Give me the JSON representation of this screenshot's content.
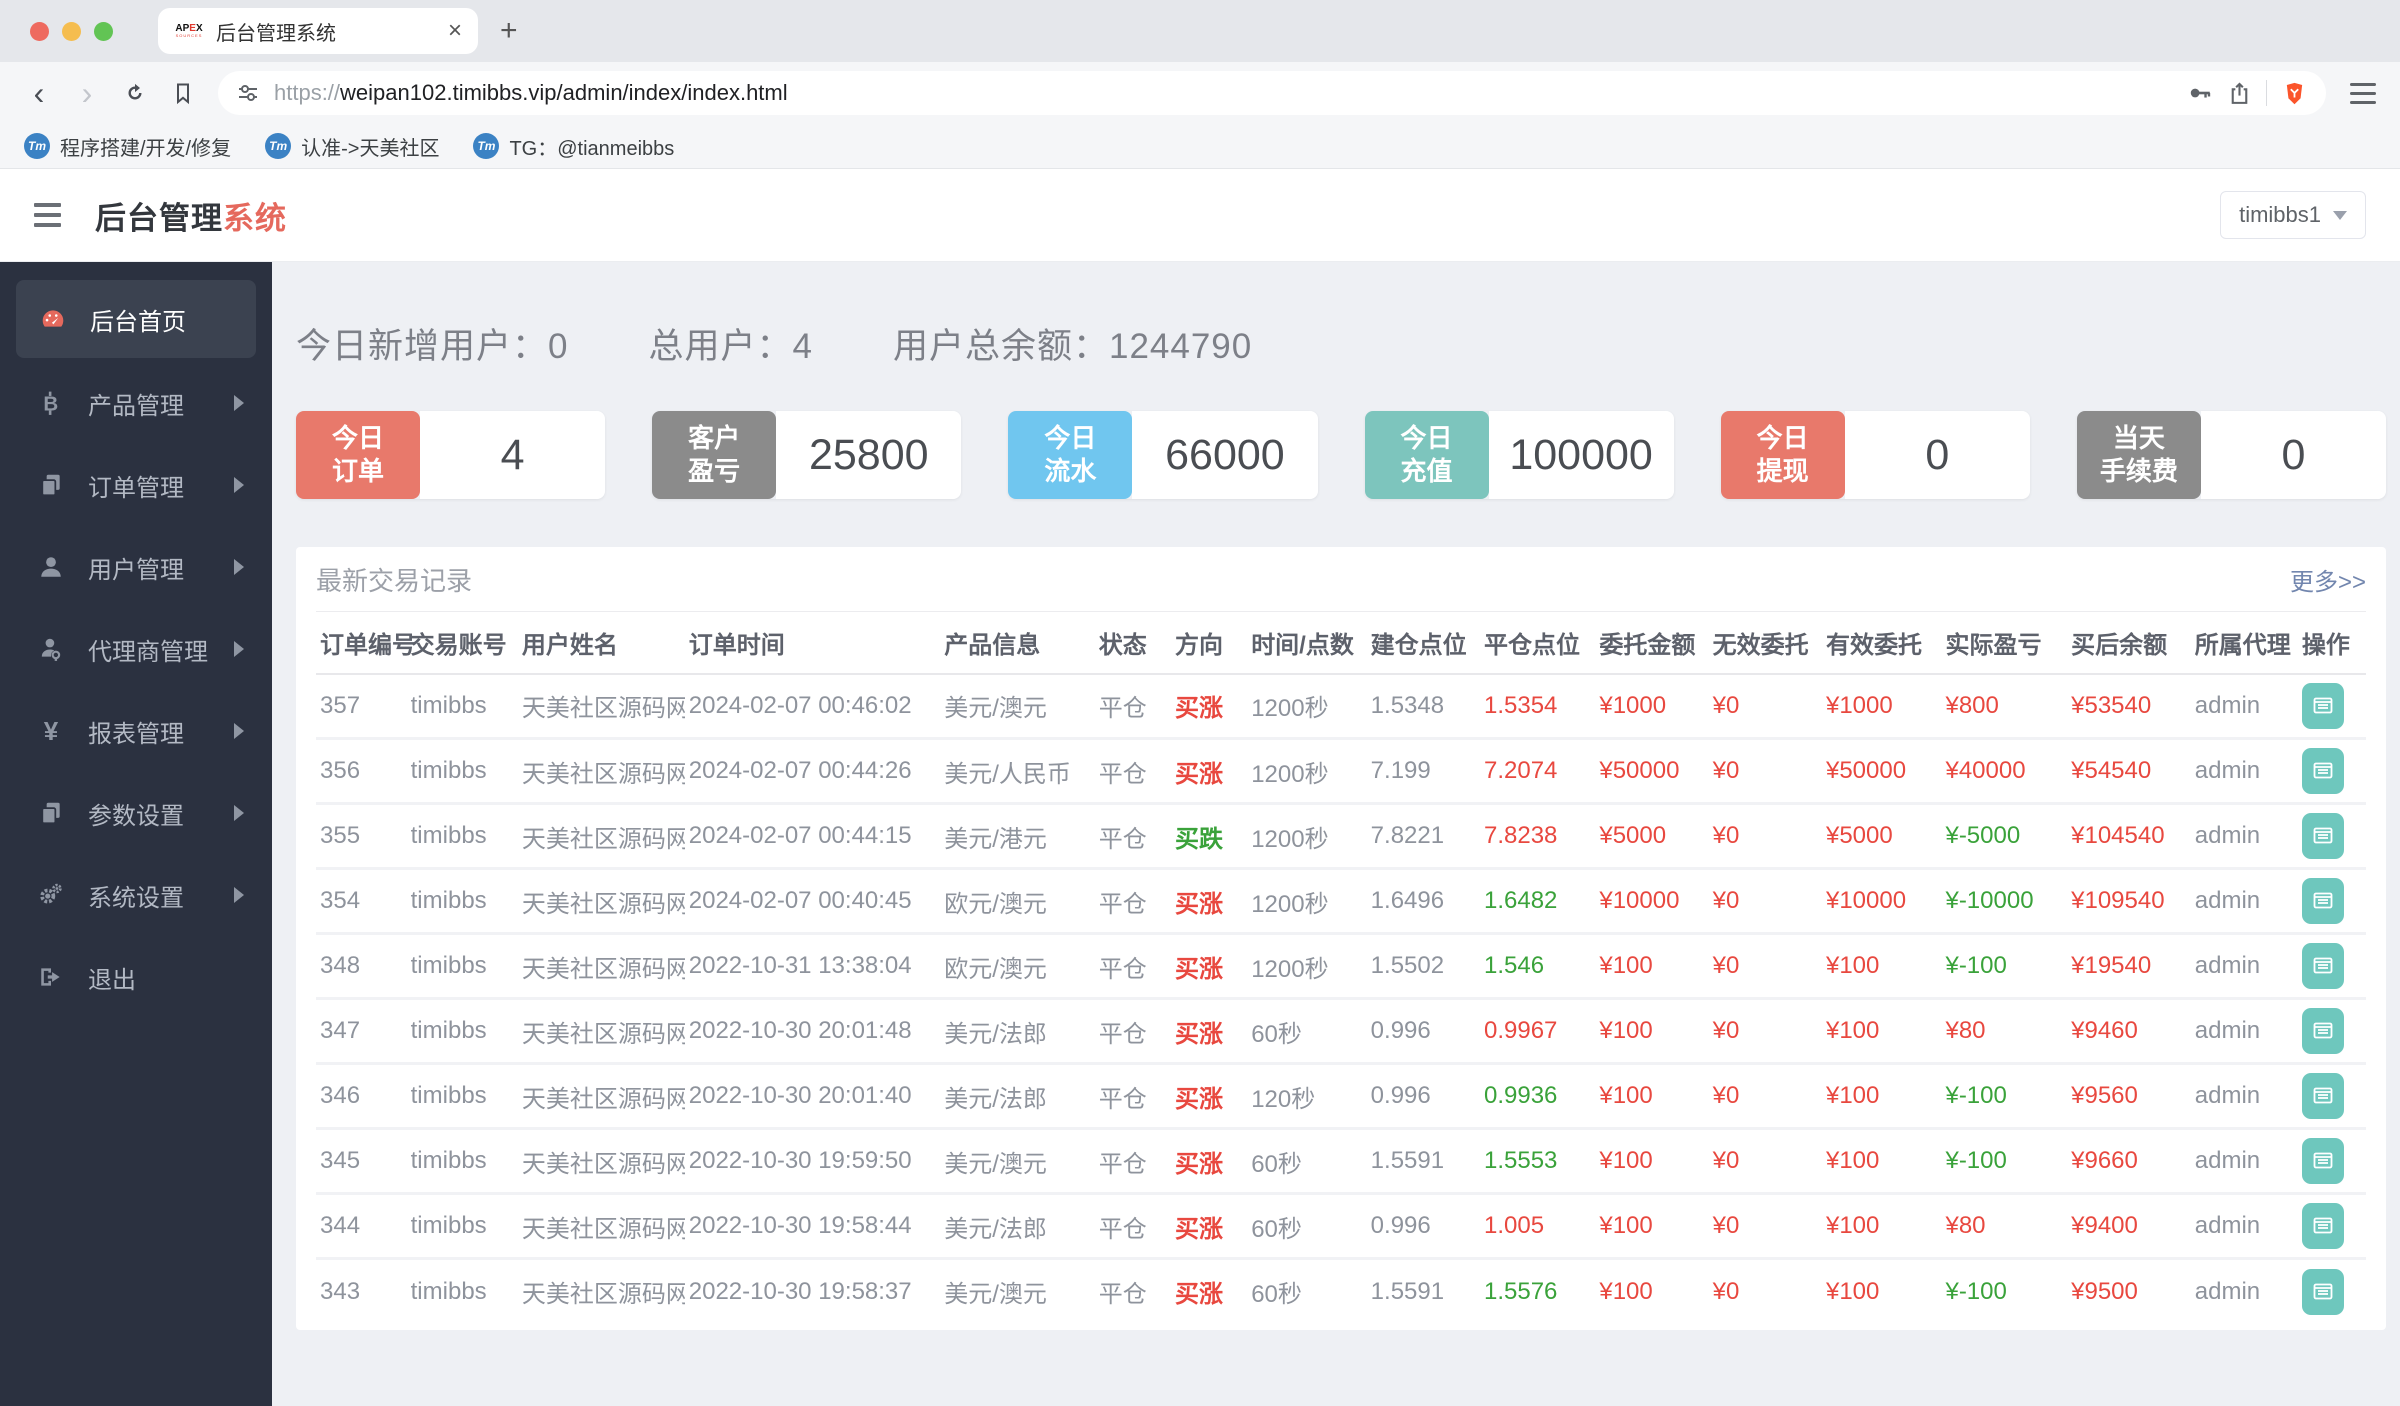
{
  "browser": {
    "tab": {
      "title": "后台管理系统",
      "favicon_line1": "APEX",
      "favicon_line2": "SOURCES"
    },
    "url": {
      "scheme": "https://",
      "host": "weipan102.timibbs.vip",
      "path": "/admin/index/index.html"
    },
    "bookmark_icon_text": "Tm",
    "bookmarks": [
      {
        "label": "程序搭建/开发/修复"
      },
      {
        "label": "认准->天美社区"
      },
      {
        "label": "TG：@tianmeibbs"
      }
    ]
  },
  "header": {
    "title_black": "后台管理",
    "title_red": "系统",
    "user": "timibbs1"
  },
  "sidebar": {
    "items": [
      {
        "label": "后台首页"
      },
      {
        "label": "产品管理"
      },
      {
        "label": "订单管理"
      },
      {
        "label": "用户管理"
      },
      {
        "label": "代理商管理"
      },
      {
        "label": "报表管理"
      },
      {
        "label": "参数设置"
      },
      {
        "label": "系统设置"
      },
      {
        "label": "退出"
      }
    ]
  },
  "stats": {
    "new_users_label": "今日新增用户：",
    "new_users": "0",
    "total_users_label": "总用户：",
    "total_users": "4",
    "total_balance_label": "用户总余额：",
    "total_balance": "1244790"
  },
  "cards": [
    {
      "line1": "今日",
      "line2": "订单",
      "value": "4",
      "color": "#e8796b"
    },
    {
      "line1": "客户",
      "line2": "盈亏",
      "value": "25800",
      "color": "#8b8b8b"
    },
    {
      "line1": "今日",
      "line2": "流水",
      "value": "66000",
      "color": "#70c6ef"
    },
    {
      "line1": "今日",
      "line2": "充值",
      "value": "100000",
      "color": "#7dc5bd"
    },
    {
      "line1": "今日",
      "line2": "提现",
      "value": "0",
      "color": "#e8796b"
    },
    {
      "line1": "当天",
      "line2": "手续费",
      "value": "0",
      "color": "#8b8b8b"
    }
  ],
  "table": {
    "title": "最新交易记录",
    "more_link": "更多>>",
    "columns": [
      "订单编号",
      "交易账号",
      "用户姓名",
      "订单时间",
      "产品信息",
      "状态",
      "方向",
      "时间/点数",
      "建仓点位",
      "平仓点位",
      "委托金额",
      "无效委托",
      "有效委托",
      "实际盈亏",
      "买后余额",
      "所属代理",
      "操作"
    ],
    "rows": [
      {
        "id": "357",
        "account": "timibbs",
        "name": "天美社区源码网",
        "time": "2024-02-07 00:46:02",
        "product": "美元/澳元",
        "status": "平仓",
        "direction": "买涨",
        "direction_color": "red",
        "duration": "1200秒",
        "open": "1.5348",
        "close": "1.5354",
        "close_color": "red",
        "amount": "¥1000",
        "invalid": "¥0",
        "valid": "¥1000",
        "profit": "¥800",
        "profit_color": "red",
        "balance": "¥53540",
        "agent": "admin"
      },
      {
        "id": "356",
        "account": "timibbs",
        "name": "天美社区源码网",
        "time": "2024-02-07 00:44:26",
        "product": "美元/人民币",
        "status": "平仓",
        "direction": "买涨",
        "direction_color": "red",
        "duration": "1200秒",
        "open": "7.199",
        "close": "7.2074",
        "close_color": "red",
        "amount": "¥50000",
        "invalid": "¥0",
        "valid": "¥50000",
        "profit": "¥40000",
        "profit_color": "red",
        "balance": "¥54540",
        "agent": "admin"
      },
      {
        "id": "355",
        "account": "timibbs",
        "name": "天美社区源码网",
        "time": "2024-02-07 00:44:15",
        "product": "美元/港元",
        "status": "平仓",
        "direction": "买跌",
        "direction_color": "green",
        "duration": "1200秒",
        "open": "7.8221",
        "close": "7.8238",
        "close_color": "red",
        "amount": "¥5000",
        "invalid": "¥0",
        "valid": "¥5000",
        "profit": "¥-5000",
        "profit_color": "green",
        "balance": "¥104540",
        "agent": "admin"
      },
      {
        "id": "354",
        "account": "timibbs",
        "name": "天美社区源码网",
        "time": "2024-02-07 00:40:45",
        "product": "欧元/澳元",
        "status": "平仓",
        "direction": "买涨",
        "direction_color": "red",
        "duration": "1200秒",
        "open": "1.6496",
        "close": "1.6482",
        "close_color": "green",
        "amount": "¥10000",
        "invalid": "¥0",
        "valid": "¥10000",
        "profit": "¥-10000",
        "profit_color": "green",
        "balance": "¥109540",
        "agent": "admin"
      },
      {
        "id": "348",
        "account": "timibbs",
        "name": "天美社区源码网",
        "time": "2022-10-31 13:38:04",
        "product": "欧元/澳元",
        "status": "平仓",
        "direction": "买涨",
        "direction_color": "red",
        "duration": "1200秒",
        "open": "1.5502",
        "close": "1.546",
        "close_color": "green",
        "amount": "¥100",
        "invalid": "¥0",
        "valid": "¥100",
        "profit": "¥-100",
        "profit_color": "green",
        "balance": "¥19540",
        "agent": "admin"
      },
      {
        "id": "347",
        "account": "timibbs",
        "name": "天美社区源码网",
        "time": "2022-10-30 20:01:48",
        "product": "美元/法郎",
        "status": "平仓",
        "direction": "买涨",
        "direction_color": "red",
        "duration": "60秒",
        "open": "0.996",
        "close": "0.9967",
        "close_color": "red",
        "amount": "¥100",
        "invalid": "¥0",
        "valid": "¥100",
        "profit": "¥80",
        "profit_color": "red",
        "balance": "¥9460",
        "agent": "admin"
      },
      {
        "id": "346",
        "account": "timibbs",
        "name": "天美社区源码网",
        "time": "2022-10-30 20:01:40",
        "product": "美元/法郎",
        "status": "平仓",
        "direction": "买涨",
        "direction_color": "red",
        "duration": "120秒",
        "open": "0.996",
        "close": "0.9936",
        "close_color": "green",
        "amount": "¥100",
        "invalid": "¥0",
        "valid": "¥100",
        "profit": "¥-100",
        "profit_color": "green",
        "balance": "¥9560",
        "agent": "admin"
      },
      {
        "id": "345",
        "account": "timibbs",
        "name": "天美社区源码网",
        "time": "2022-10-30 19:59:50",
        "product": "美元/澳元",
        "status": "平仓",
        "direction": "买涨",
        "direction_color": "red",
        "duration": "60秒",
        "open": "1.5591",
        "close": "1.5553",
        "close_color": "green",
        "amount": "¥100",
        "invalid": "¥0",
        "valid": "¥100",
        "profit": "¥-100",
        "profit_color": "green",
        "balance": "¥9660",
        "agent": "admin"
      },
      {
        "id": "344",
        "account": "timibbs",
        "name": "天美社区源码网",
        "time": "2022-10-30 19:58:44",
        "product": "美元/法郎",
        "status": "平仓",
        "direction": "买涨",
        "direction_color": "red",
        "duration": "60秒",
        "open": "0.996",
        "close": "1.005",
        "close_color": "red",
        "amount": "¥100",
        "invalid": "¥0",
        "valid": "¥100",
        "profit": "¥80",
        "profit_color": "red",
        "balance": "¥9400",
        "agent": "admin"
      },
      {
        "id": "343",
        "account": "timibbs",
        "name": "天美社区源码网",
        "time": "2022-10-30 19:58:37",
        "product": "美元/澳元",
        "status": "平仓",
        "direction": "买涨",
        "direction_color": "red",
        "duration": "60秒",
        "open": "1.5591",
        "close": "1.5576",
        "close_color": "green",
        "amount": "¥100",
        "invalid": "¥0",
        "valid": "¥100",
        "profit": "¥-100",
        "profit_color": "green",
        "balance": "¥9500",
        "agent": "admin"
      }
    ]
  },
  "colors": {
    "accent_red": "#e5695d",
    "text_red": "#e8483f",
    "text_green": "#3aa23a",
    "sidebar_bg": "#2b3140",
    "link_blue": "#7286ae",
    "brave_orange": "#fb542b"
  }
}
